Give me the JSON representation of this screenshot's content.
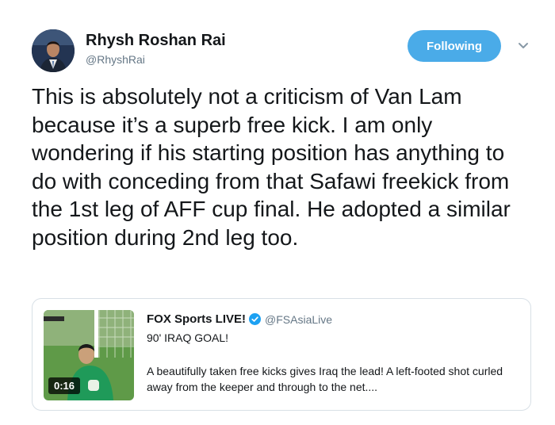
{
  "user": {
    "display_name": "Rhysh Roshan Rai",
    "handle": "@RhyshRai",
    "follow_label": "Following"
  },
  "tweet": {
    "text": "This is absolutely not a criticism of Van Lam because it’s a superb free kick. I am only wondering if his starting position has anything to do with conceding from that Safawi freekick from the 1st leg of AFF cup final. He adopted a similar position during 2nd leg too."
  },
  "card": {
    "author_name": "FOX Sports LIVE!",
    "author_handle": "@FSAsiaLive",
    "headline": "90' IRAQ GOAL!",
    "description": "A beautifully taken free kicks gives Iraq the lead! A left-footed shot curled away from the keeper and through to the net....",
    "duration": "0:16"
  },
  "icons": {
    "caret": "chevron-down-icon",
    "verified": "verified-badge-icon",
    "avatar": "profile-photo"
  },
  "colors": {
    "accent": "#4aabe8",
    "secondary_text": "#657786",
    "verified": "#1da1f2"
  }
}
